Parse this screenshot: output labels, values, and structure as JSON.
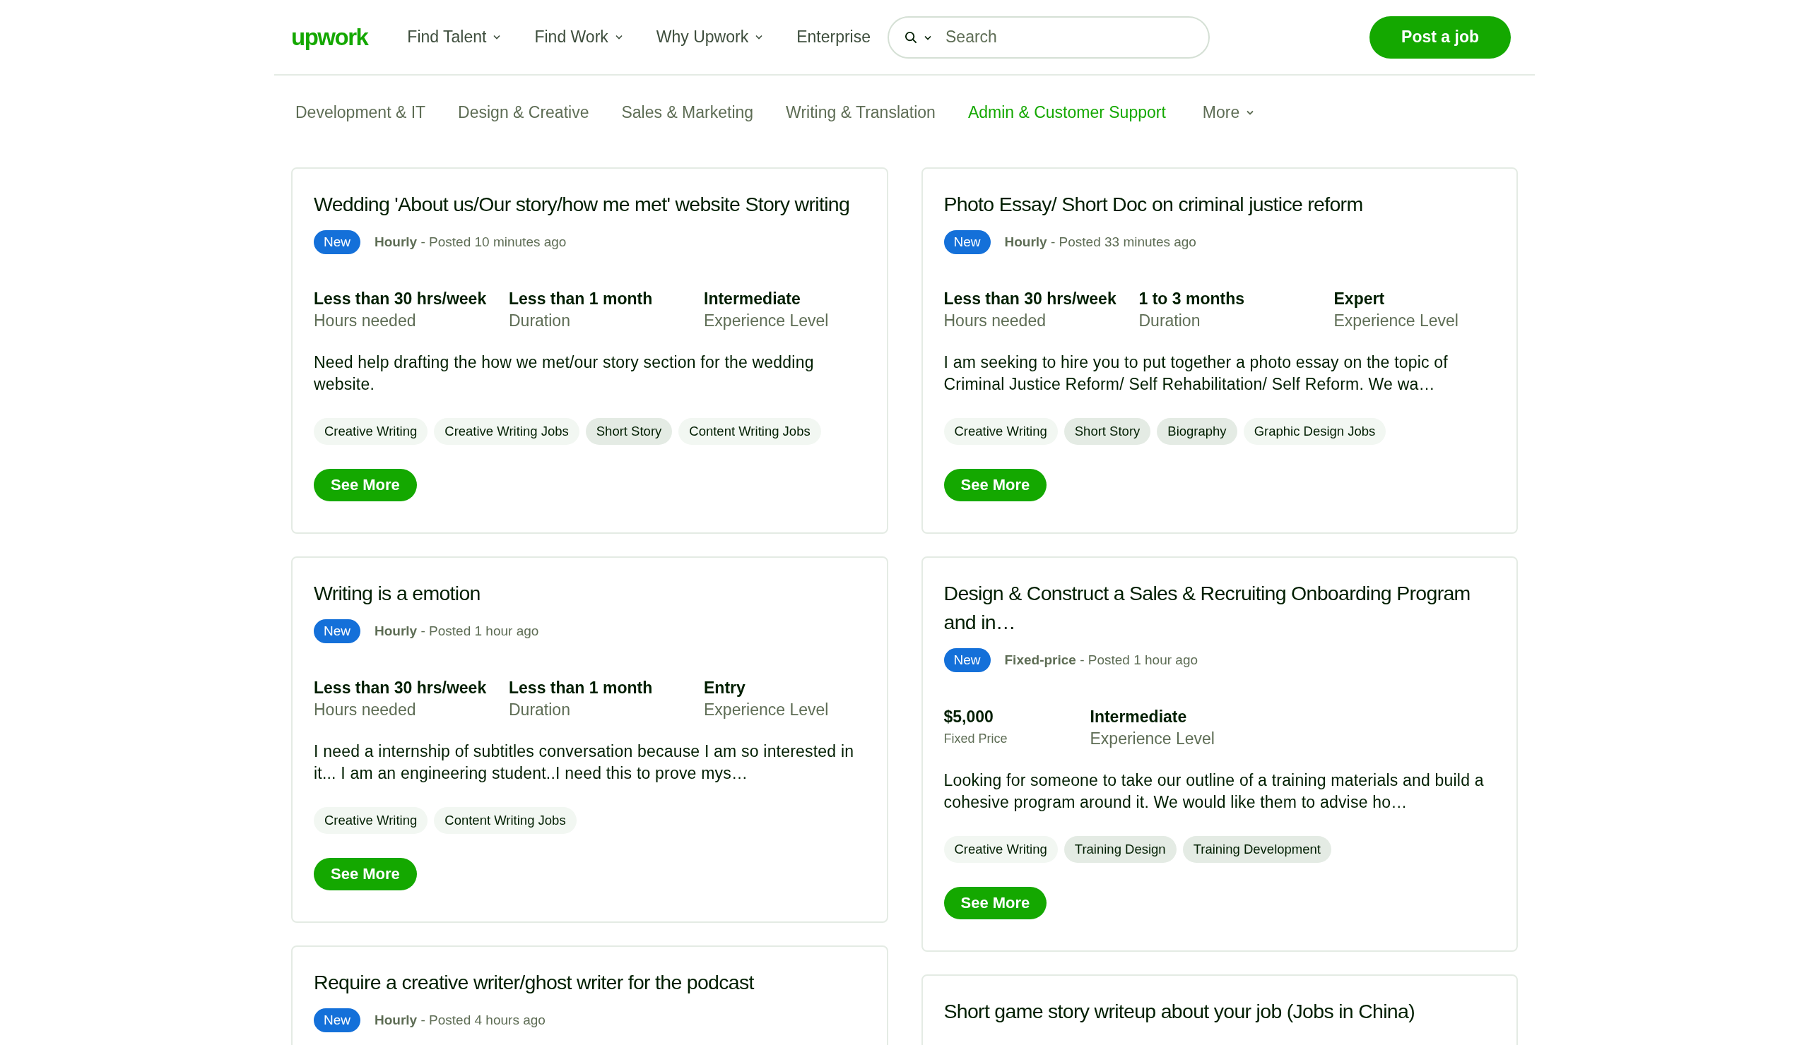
{
  "header": {
    "logo": "upwork",
    "nav": [
      {
        "label": "Find Talent",
        "dropdown": true
      },
      {
        "label": "Find Work",
        "dropdown": true
      },
      {
        "label": "Why Upwork",
        "dropdown": true
      },
      {
        "label": "Enterprise",
        "dropdown": false
      }
    ],
    "search": {
      "placeholder": "Search"
    },
    "post_button": "Post a job"
  },
  "categories": [
    {
      "label": "Development & IT",
      "selected": false,
      "dropdown": false
    },
    {
      "label": "Design & Creative",
      "selected": false,
      "dropdown": false
    },
    {
      "label": "Sales & Marketing",
      "selected": false,
      "dropdown": false
    },
    {
      "label": "Writing & Translation",
      "selected": false,
      "dropdown": false
    },
    {
      "label": "Admin & Customer Support",
      "selected": true,
      "dropdown": false
    },
    {
      "label": "More",
      "selected": false,
      "dropdown": true
    }
  ],
  "columns": [
    {
      "jobs": [
        {
          "title": "Wedding 'About us/Our story/how me met' website Story writing",
          "badge": "New",
          "type": "Hourly",
          "posted": " - Posted 10 minutes ago",
          "stats": [
            {
              "kind": "term",
              "value": "Less than 30 hrs/week",
              "label": "Hours needed"
            },
            {
              "kind": "term",
              "value": "Less than 1 month",
              "label": "Duration"
            },
            {
              "kind": "term",
              "value": "Intermediate",
              "label": "Experience Level"
            }
          ],
          "description": "Need help drafting the how we met/our story section for the wedding website.",
          "tags": [
            {
              "label": "Creative Writing",
              "highlighted": false
            },
            {
              "label": "Creative Writing Jobs",
              "highlighted": false
            },
            {
              "label": "Short Story",
              "highlighted": true
            },
            {
              "label": "Content Writing Jobs",
              "highlighted": false
            }
          ],
          "button": "See More"
        },
        {
          "title": "Writing is a emotion",
          "badge": "New",
          "type": "Hourly",
          "posted": " - Posted 1 hour ago",
          "stats": [
            {
              "kind": "term",
              "value": "Less than 30 hrs/week",
              "label": "Hours needed"
            },
            {
              "kind": "term",
              "value": "Less than 1 month",
              "label": "Duration"
            },
            {
              "kind": "term",
              "value": "Entry",
              "label": "Experience Level"
            }
          ],
          "description": "I need a internship of subtitles conversation because I am so interested in it... I am an engineering student..I need this to prove mys…",
          "tags": [
            {
              "label": "Creative Writing",
              "highlighted": false
            },
            {
              "label": "Content Writing Jobs",
              "highlighted": false
            }
          ],
          "button": "See More"
        },
        {
          "title": "Require a creative writer/ghost writer for the podcast",
          "badge": "New",
          "type": "Hourly",
          "posted": " - Posted 4 hours ago"
        }
      ]
    },
    {
      "jobs": [
        {
          "title": "Photo Essay/ Short Doc on criminal justice reform",
          "badge": "New",
          "type": "Hourly",
          "posted": " - Posted 33 minutes ago",
          "stats": [
            {
              "kind": "term",
              "value": "Less than 30 hrs/week",
              "label": "Hours needed"
            },
            {
              "kind": "term",
              "value": "1 to 3 months",
              "label": "Duration"
            },
            {
              "kind": "term",
              "value": "Expert",
              "label": "Experience Level"
            }
          ],
          "description": "I am seeking to hire you to put together a photo essay on the topic of Criminal Justice Reform/ Self Rehabilitation/ Self Reform. We wa…",
          "tags": [
            {
              "label": "Creative Writing",
              "highlighted": false
            },
            {
              "label": "Short Story",
              "highlighted": true
            },
            {
              "label": "Biography",
              "highlighted": true
            },
            {
              "label": "Graphic Design Jobs",
              "highlighted": false
            }
          ],
          "button": "See More"
        },
        {
          "title": "Design & Construct a Sales & Recruiting Onboarding Program and in…",
          "badge": "New",
          "type": "Fixed-price",
          "posted": " - Posted 1 hour ago",
          "stats": [
            {
              "kind": "price",
              "value": "$5,000",
              "label": "Fixed Price"
            },
            {
              "kind": "term",
              "value": "Intermediate",
              "label": "Experience Level"
            }
          ],
          "description": "Looking for someone to take our outline of a training materials and build a cohesive program around it. We would like them to advise ho…",
          "tags": [
            {
              "label": "Creative Writing",
              "highlighted": false
            },
            {
              "label": "Training Design",
              "highlighted": true
            },
            {
              "label": "Training Development",
              "highlighted": true
            }
          ],
          "button": "See More"
        },
        {
          "title": "Short game story writeup about your job (Jobs in China)"
        }
      ]
    }
  ]
}
